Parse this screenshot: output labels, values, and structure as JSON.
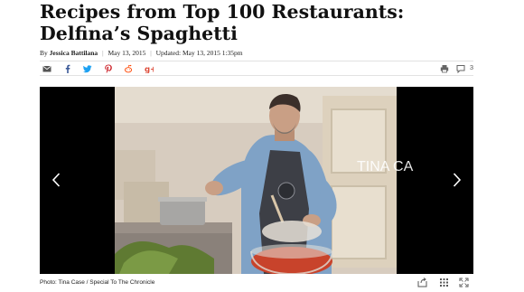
{
  "article": {
    "title": "Recipes from Top 100 Restaurants: Delfina’s Spaghetti",
    "byline": {
      "by": "By",
      "author": "Jessica Battilana",
      "date": "May 13, 2015",
      "updated": "Updated: May 13, 2015 1:35pm"
    }
  },
  "share": {
    "icons": [
      "email-icon",
      "facebook-icon",
      "twitter-icon",
      "pinterest-icon",
      "reddit-icon",
      "google-plus-icon"
    ],
    "comment_count": "3"
  },
  "gallery": {
    "watermark": "TINA CA",
    "caption": "Photo: Tina Case / Special To The Chronicle"
  },
  "colors": {
    "facebook": "#3b5998",
    "twitter": "#1da1f2",
    "pinterest": "#cb2027",
    "reddit": "#ff4500",
    "google_plus": "#dd4b39"
  }
}
